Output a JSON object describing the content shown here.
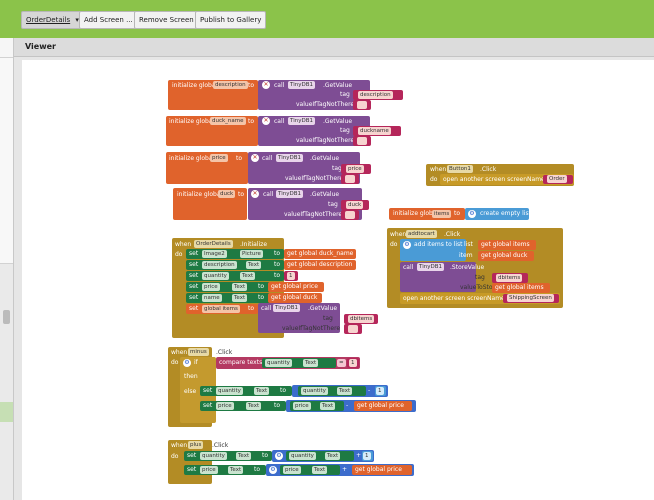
{
  "toolbar": {
    "screen_select": "OrderDetails",
    "add_screen": "Add Screen ...",
    "remove_screen": "Remove Screen",
    "publish": "Publish to Gallery"
  },
  "viewer": {
    "title": "Viewer"
  },
  "blocks": {
    "init_description": {
      "label": "initialize global",
      "var": "description",
      "to": "to",
      "call": "call",
      "comp": "TinyDB1",
      "method": ".GetValue",
      "tag": "tag",
      "tag_val": "description",
      "vit": "valueIfTagNotThere",
      "empty": ""
    },
    "init_duck_name": {
      "label": "initialize global",
      "var": "duck_name",
      "to": "to",
      "call": "call",
      "comp": "TinyDB1",
      "method": ".GetValue",
      "tag": "tag",
      "tag_val": "duckname",
      "vit": "valueIfTagNotThere",
      "empty": ""
    },
    "init_price": {
      "label": "initialize global",
      "var": "price",
      "to": "to",
      "call": "call",
      "comp": "TinyDB1",
      "method": ".GetValue",
      "tag": "tag",
      "tag_val": "price",
      "vit": "valueIfTagNotThere",
      "empty": ""
    },
    "init_duck": {
      "label": "initialize global",
      "var": "duck",
      "to": "to",
      "call": "call",
      "comp": "TinyDB1",
      "method": ".GetValue",
      "tag": "tag",
      "tag_val": "duck",
      "vit": "valueIfTagNotThere",
      "empty": ""
    },
    "button1_click": {
      "when": "when",
      "comp": "Button1",
      "event": ".Click",
      "do": "do",
      "action": "open another screen  screenName",
      "screen": "Order"
    },
    "init_items": {
      "label": "initialize global",
      "var": "items",
      "to": "to",
      "value": "create empty list"
    },
    "addtocart_click": {
      "when": "when",
      "comp": "addtocart",
      "event": ".Click",
      "do": "do",
      "add_items": "add items to list",
      "list": "list",
      "get_items": "get  global items",
      "item": "item",
      "get_duck": "get  global duck",
      "call": "call",
      "db": "TinyDB1",
      "store": ".StoreValue",
      "tag": "tag",
      "tag_val": "dbitems",
      "vts": "valueToStore",
      "get_items2": "get  global items",
      "open_screen": "open another screen  screenName",
      "screen": "ShippingScreen"
    },
    "orderdetails_init": {
      "when": "when",
      "comp": "OrderDetails",
      "event": ".Initialize",
      "do": "do",
      "rows": [
        {
          "set": "set",
          "comp": "Image2",
          "prop": "Picture",
          "to": "to",
          "value": "get  global duck_name"
        },
        {
          "set": "set",
          "comp": "description",
          "prop": "Text",
          "to": "to",
          "value": "get  global description"
        },
        {
          "set": "set",
          "comp": "quantity",
          "prop": "Text",
          "to": "to",
          "value": "1"
        },
        {
          "set": "set",
          "comp": "price",
          "prop": "Text",
          "to": "to",
          "value": "get  global price"
        },
        {
          "set": "set",
          "comp": "name",
          "prop": "Text",
          "to": "to",
          "value": "get  global duck"
        },
        {
          "set": "set",
          "comp": "global items",
          "prop": "",
          "to": "to",
          "value": ""
        }
      ],
      "call": "call",
      "db": "TinyDB1",
      "method": ".GetValue",
      "tag": "tag",
      "tag_val": "dbitems",
      "vit": "valueIfTagNotThere",
      "empty": ""
    },
    "minus_click": {
      "when": "when",
      "comp": "minus",
      "event": ".Click",
      "do": "do",
      "if": "if",
      "compare": "compare texts",
      "cmp_comp": "quantity",
      "cmp_prop": "Text",
      "op": "=",
      "cmp_val": "1",
      "then": "then",
      "else": "else",
      "set1": "set",
      "s1_comp": "quantity",
      "s1_prop": "Text",
      "s1_to": "to",
      "s1_comp2": "quantity",
      "s1_prop2": "Text",
      "s1_op": "-",
      "s1_val": "1",
      "set2": "set",
      "s2_comp": "price",
      "s2_prop": "Text",
      "s2_to": "to",
      "s2_comp2": "price",
      "s2_prop2": "Text",
      "s2_op": "-",
      "s2_get": "get  global price"
    },
    "plus_click": {
      "when": "when",
      "comp": "plus",
      "event": ".Click",
      "do": "do",
      "set1": "set",
      "s1_comp": "quantity",
      "s1_prop": "Text",
      "s1_to": "to",
      "s1_comp2": "quantity",
      "s1_prop2": "Text",
      "s1_op": "+",
      "s1_val": "1",
      "set2": "set",
      "s2_comp": "price",
      "s2_prop": "Text",
      "s2_to": "to",
      "s2_comp2": "price",
      "s2_prop2": "Text",
      "s2_op": "+",
      "s2_get": "get  global price"
    }
  },
  "colors": {
    "topbar": "#8bc34a",
    "variable": "#e0632c",
    "component_call": "#7e4d94",
    "text": "#b5265a",
    "event": "#b38c25",
    "list": "#4a9bd6",
    "setter": "#1e7a43",
    "math": "#3c6ccc"
  }
}
